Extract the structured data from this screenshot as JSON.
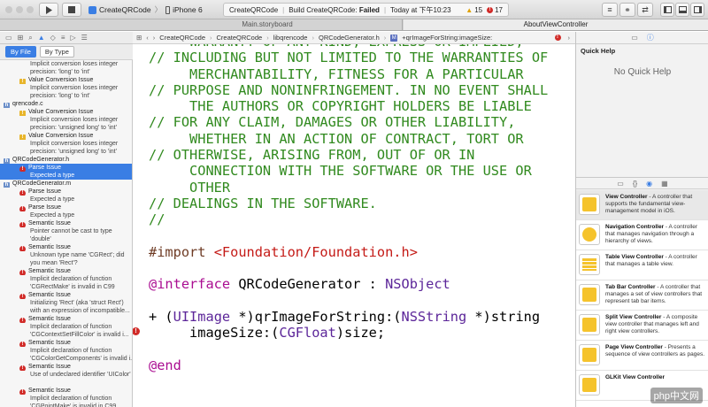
{
  "toolbar": {
    "run_icon": "play-icon",
    "stop_icon": "stop-icon",
    "scheme": "CreateQRCode",
    "device": "iPhone 6",
    "status_project": "CreateQRCode",
    "status_build": "Build CreateQRCode:",
    "status_result": "Failed",
    "status_time": "Today at 下午10:23",
    "warnings": "15",
    "errors": "17"
  },
  "tabs": [
    "Main.storyboard",
    "AboutViewController"
  ],
  "navigator": {
    "filter_by_file": "By File",
    "filter_by_type": "By Type",
    "rows": [
      {
        "kind": "detail",
        "text": "Implicit conversion loses integer"
      },
      {
        "kind": "detail",
        "text": "precision: 'long' to 'int'"
      },
      {
        "kind": "issue",
        "icon": "warn",
        "text": "Value Conversion Issue"
      },
      {
        "kind": "detail",
        "text": "Implicit conversion loses integer"
      },
      {
        "kind": "detail",
        "text": "precision: 'long' to 'int'"
      },
      {
        "kind": "file",
        "icon": "file",
        "text": "qrencode.c"
      },
      {
        "kind": "issue",
        "icon": "warn",
        "text": "Value Conversion Issue"
      },
      {
        "kind": "detail",
        "text": "Implicit conversion loses integer"
      },
      {
        "kind": "detail",
        "text": "precision: 'unsigned long' to 'int'"
      },
      {
        "kind": "issue",
        "icon": "warn",
        "text": "Value Conversion Issue"
      },
      {
        "kind": "detail",
        "text": "Implicit conversion loses integer"
      },
      {
        "kind": "detail",
        "text": "precision: 'unsigned long' to 'int'"
      },
      {
        "kind": "file",
        "icon": "file",
        "text": "QRCodeGenerator.h"
      },
      {
        "kind": "issue",
        "icon": "err",
        "text": "Parse Issue",
        "sel": true
      },
      {
        "kind": "detail",
        "text": "Expected a type",
        "sel": true
      },
      {
        "kind": "file",
        "icon": "file",
        "text": "QRCodeGenerator.m"
      },
      {
        "kind": "issue",
        "icon": "err",
        "text": "Parse Issue"
      },
      {
        "kind": "detail",
        "text": "Expected a type"
      },
      {
        "kind": "issue",
        "icon": "err",
        "text": "Parse Issue"
      },
      {
        "kind": "detail",
        "text": "Expected a type"
      },
      {
        "kind": "issue",
        "icon": "err",
        "text": "Semantic Issue"
      },
      {
        "kind": "detail",
        "text": "Pointer cannot be cast to type"
      },
      {
        "kind": "detail",
        "text": "'double'"
      },
      {
        "kind": "issue",
        "icon": "err",
        "text": "Semantic Issue"
      },
      {
        "kind": "detail",
        "text": "Unknown type name 'CGRect'; did"
      },
      {
        "kind": "detail",
        "text": "you mean 'Rect'?"
      },
      {
        "kind": "issue",
        "icon": "err",
        "text": "Semantic Issue"
      },
      {
        "kind": "detail",
        "text": "Implicit declaration of function"
      },
      {
        "kind": "detail",
        "text": "'CGRectMake' is invalid in C99"
      },
      {
        "kind": "issue",
        "icon": "err",
        "text": "Semantic Issue"
      },
      {
        "kind": "detail",
        "text": "Initializing 'Rect' (aka 'struct Rect')"
      },
      {
        "kind": "detail",
        "text": "with an expression of incompatible..."
      },
      {
        "kind": "issue",
        "icon": "err",
        "text": "Semantic Issue"
      },
      {
        "kind": "detail",
        "text": "Implicit declaration of function"
      },
      {
        "kind": "detail",
        "text": "'CGContextSetFillColor' is invalid i..."
      },
      {
        "kind": "issue",
        "icon": "err",
        "text": "Semantic Issue"
      },
      {
        "kind": "detail",
        "text": "Implicit declaration of function"
      },
      {
        "kind": "detail",
        "text": "'CGColorGetComponents' is invalid i..."
      },
      {
        "kind": "issue",
        "icon": "err",
        "text": "Semantic Issue"
      },
      {
        "kind": "detail",
        "text": "Use of undeclared identifier 'UIColor'"
      },
      {
        "kind": "detail",
        "text": ""
      },
      {
        "kind": "issue",
        "icon": "err",
        "text": "Semantic Issue"
      },
      {
        "kind": "detail",
        "text": "Implicit declaration of function"
      },
      {
        "kind": "detail",
        "text": "'CGPointMake' is invalid in C99"
      }
    ]
  },
  "jumpbar": [
    "CreateQRCode",
    "CreateQRCode",
    "libqrencode",
    "QRCodeGenerator.h",
    "+qrImageForString:imageSize:"
  ],
  "editor": {
    "lines": [
      [
        [
          "cmt",
          "     WARRANTY OF ANY KIND, EXPRESS OR IMPLIED,"
        ]
      ],
      [
        [
          "cmt",
          "// INCLUDING BUT NOT LIMITED TO THE WARRANTIES OF"
        ]
      ],
      [
        [
          "cmt",
          "     MERCHANTABILITY, FITNESS FOR A PARTICULAR"
        ]
      ],
      [
        [
          "cmt",
          "// PURPOSE AND NONINFRINGEMENT. IN NO EVENT SHALL"
        ]
      ],
      [
        [
          "cmt",
          "     THE AUTHORS OR COPYRIGHT HOLDERS BE LIABLE"
        ]
      ],
      [
        [
          "cmt",
          "// FOR ANY CLAIM, DAMAGES OR OTHER LIABILITY,"
        ]
      ],
      [
        [
          "cmt",
          "     WHETHER IN AN ACTION OF CONTRACT, TORT OR"
        ]
      ],
      [
        [
          "cmt",
          "// OTHERWISE, ARISING FROM, OUT OF OR IN"
        ]
      ],
      [
        [
          "cmt",
          "     CONNECTION WITH THE SOFTWARE OR THE USE OR"
        ]
      ],
      [
        [
          "cmt",
          "     OTHER"
        ]
      ],
      [
        [
          "cmt",
          "// DEALINGS IN THE SOFTWARE."
        ]
      ],
      [
        [
          "cmt",
          "//"
        ]
      ],
      [
        [
          "pl",
          ""
        ]
      ],
      [
        [
          "dir",
          "#import "
        ],
        [
          "str",
          "<Foundation/Foundation.h>"
        ]
      ],
      [
        [
          "pl",
          ""
        ]
      ],
      [
        [
          "kw",
          "@interface"
        ],
        [
          "pl",
          " QRCodeGenerator : "
        ],
        [
          "ty",
          "NSObject"
        ]
      ],
      [
        [
          "pl",
          ""
        ]
      ],
      [
        [
          "pl",
          "+ ("
        ],
        [
          "ty",
          "UIImage"
        ],
        [
          "pl",
          " *)qrImageForString:("
        ],
        [
          "ty",
          "NSString"
        ],
        [
          "pl",
          " *)string"
        ]
      ],
      [
        [
          "pl",
          "     imageSize:("
        ],
        [
          "ty",
          "CGFloat"
        ],
        [
          "pl",
          ")size;"
        ]
      ],
      [
        [
          "pl",
          ""
        ]
      ],
      [
        [
          "kw",
          "@end"
        ]
      ]
    ],
    "error_marker": "!"
  },
  "inspector": {
    "title": "Quick Help",
    "empty": "No Quick Help",
    "library": [
      {
        "name": "View Controller",
        "desc": " - A controller that supports the fundamental view-management model in iOS.",
        "icon": "view-controller-icon"
      },
      {
        "name": "Navigation Controller",
        "desc": " - A controller that manages navigation through a hierarchy of views.",
        "icon": "navigation-controller-icon"
      },
      {
        "name": "Table View Controller",
        "desc": " - A controller that manages a table view.",
        "icon": "table-view-controller-icon"
      },
      {
        "name": "Tab Bar Controller",
        "desc": " - A controller that manages a set of view controllers that represent tab bar items.",
        "icon": "tab-bar-controller-icon"
      },
      {
        "name": "Split View Controller",
        "desc": " - A composite view controller that manages left and right view controllers.",
        "icon": "split-view-controller-icon"
      },
      {
        "name": "Page View Controller",
        "desc": " - Presents a sequence of view controllers as pages.",
        "icon": "page-view-controller-icon"
      },
      {
        "name": "GLKit View Controller",
        "desc": "",
        "icon": "glkit-view-controller-icon"
      }
    ]
  },
  "watermark": "php中文网"
}
